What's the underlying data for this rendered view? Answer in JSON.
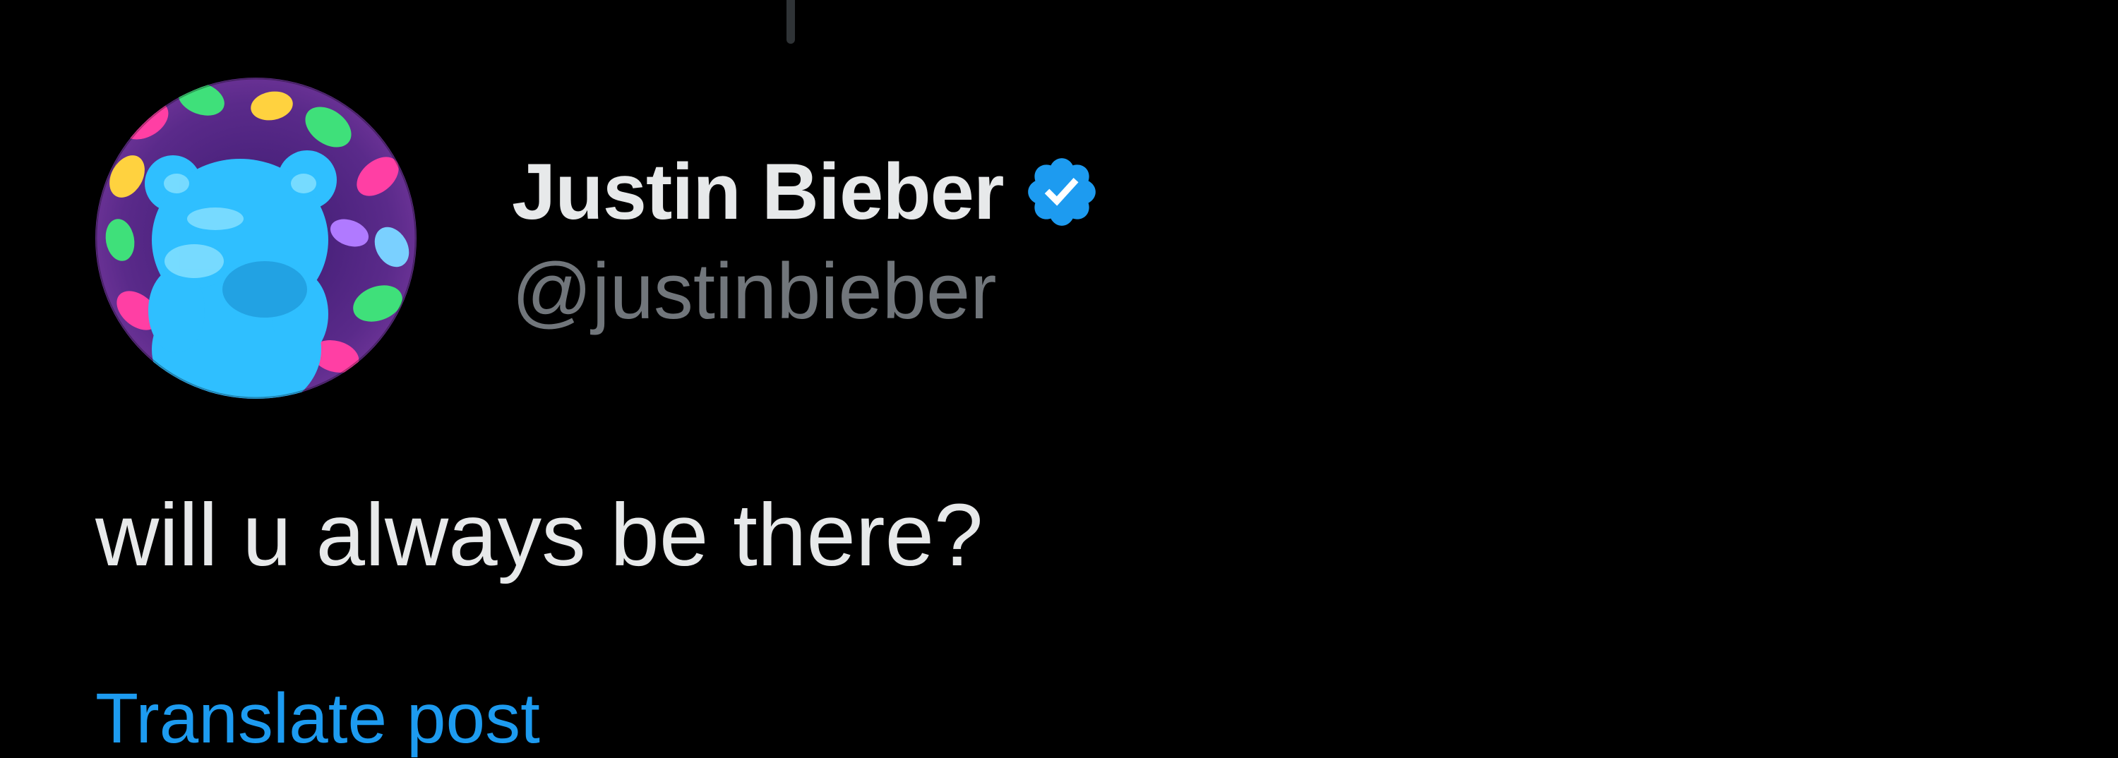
{
  "tweet": {
    "author": {
      "display_name": "Justin Bieber",
      "handle": "@justinbieber",
      "verified": true,
      "avatar_icon": "blue-gummy-bear-avatar"
    },
    "text": "will u always be there?",
    "translate_label": "Translate post"
  },
  "colors": {
    "background": "#000000",
    "primary_text": "#e7e9ea",
    "secondary_text": "#71767b",
    "accent": "#1d9bf0"
  }
}
